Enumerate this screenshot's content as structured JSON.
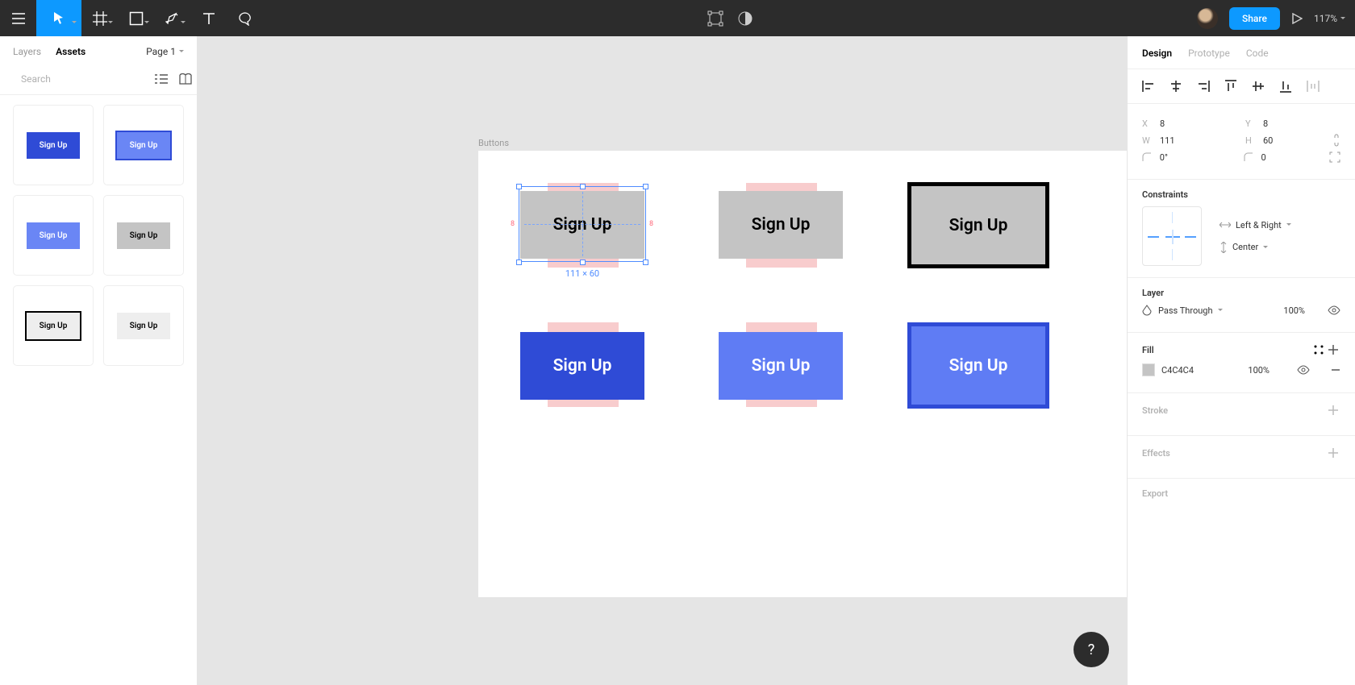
{
  "topbar": {
    "share_label": "Share",
    "zoom": "117%"
  },
  "left": {
    "tabs": {
      "layers": "Layers",
      "assets": "Assets"
    },
    "page": "Page 1",
    "search_placeholder": "Search",
    "assets": [
      {
        "label": "Sign Up",
        "bg": "#2f4bd6",
        "fg": "#ffffff",
        "border": "none"
      },
      {
        "label": "Sign Up",
        "bg": "#6a86f5",
        "fg": "#ffffff",
        "border": "2px solid #2f4bd6"
      },
      {
        "label": "Sign Up",
        "bg": "#6a86f5",
        "fg": "#ffffff",
        "border": "none"
      },
      {
        "label": "Sign Up",
        "bg": "#c4c4c4",
        "fg": "#000000",
        "border": "none"
      },
      {
        "label": "Sign Up",
        "bg": "#eeeeee",
        "fg": "#000000",
        "border": "2px solid #000000"
      },
      {
        "label": "Sign Up",
        "bg": "#eeeeee",
        "fg": "#000000",
        "border": "none"
      }
    ]
  },
  "canvas": {
    "frame_label": "Buttons",
    "selection_dim": "111 × 60",
    "ruler_left": "8",
    "ruler_right": "8",
    "buttons": [
      {
        "label": "Sign Up",
        "bg": "#c4c4c4",
        "fg": "#000000",
        "border": "none"
      },
      {
        "label": "Sign Up",
        "bg": "#c4c4c4",
        "fg": "#000000",
        "border": "none"
      },
      {
        "label": "Sign Up",
        "bg": "#c4c4c4",
        "fg": "#000000",
        "border": "5px solid #000000"
      },
      {
        "label": "Sign Up",
        "bg": "#2f4bd6",
        "fg": "#ffffff",
        "border": "none"
      },
      {
        "label": "Sign Up",
        "bg": "#5f7cf4",
        "fg": "#ffffff",
        "border": "none"
      },
      {
        "label": "Sign Up",
        "bg": "#5f7cf4",
        "fg": "#ffffff",
        "border": "5px solid #2f4bd6"
      }
    ]
  },
  "right": {
    "tabs": {
      "design": "Design",
      "prototype": "Prototype",
      "code": "Code"
    },
    "x_label": "X",
    "x_val": "8",
    "y_label": "Y",
    "y_val": "8",
    "w_label": "W",
    "w_val": "111",
    "h_label": "H",
    "h_val": "60",
    "rot_val": "0°",
    "radius_val": "0",
    "constraints_title": "Constraints",
    "constraint_h": "Left & Right",
    "constraint_v": "Center",
    "layer_title": "Layer",
    "blend_mode": "Pass Through",
    "layer_opacity": "100%",
    "fill_title": "Fill",
    "fill_hex": "C4C4C4",
    "fill_opacity": "100%",
    "stroke_title": "Stroke",
    "effects_title": "Effects",
    "export_title": "Export"
  },
  "help": "?"
}
